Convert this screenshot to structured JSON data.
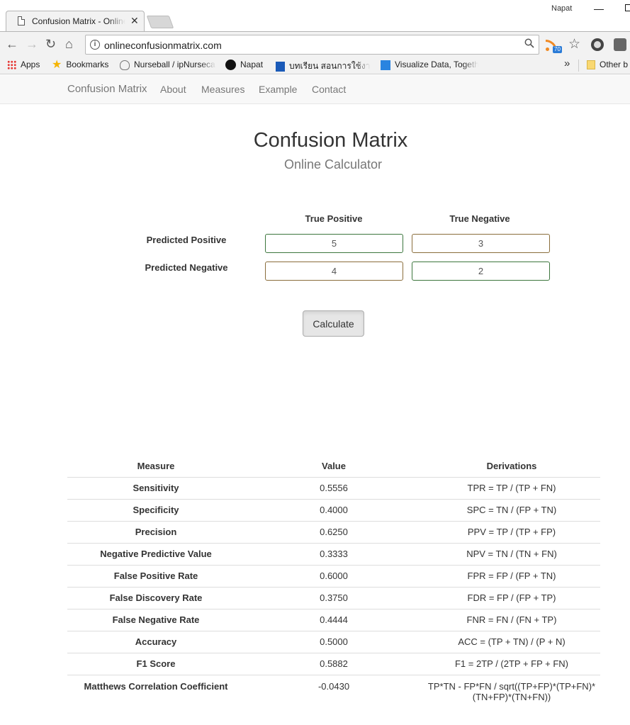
{
  "browser": {
    "tab_title": "Confusion Matrix - Online",
    "profile_name": "Napat",
    "url": "onlineconfusionmatrix.com",
    "rss_badge": "70",
    "bookmarks": [
      {
        "label": "Apps",
        "icon": "apps-grid-icon"
      },
      {
        "label": "Bookmarks",
        "icon": "star-icon"
      },
      {
        "label": "Nurseball / ipNurseca",
        "icon": "cat-icon"
      },
      {
        "label": "Napat",
        "icon": "github-icon"
      },
      {
        "label": "บทเรียน สอนการใช้งาน p",
        "icon": "doc-icon"
      },
      {
        "label": "Visualize Data, Togeth",
        "icon": "chart-icon"
      }
    ],
    "other_bookmarks": "Other b"
  },
  "nav": {
    "brand": "Confusion Matrix",
    "links": [
      "About",
      "Measures",
      "Example",
      "Contact"
    ]
  },
  "header": {
    "title": "Confusion Matrix",
    "subtitle": "Online Calculator"
  },
  "matrix": {
    "col_true_positive": "True Positive",
    "col_true_negative": "True Negative",
    "row_predicted_positive": "Predicted Positive",
    "row_predicted_negative": "Predicted Negative",
    "tp": "5",
    "fp": "3",
    "fn": "4",
    "tn": "2"
  },
  "calculate_label": "Calculate",
  "results": {
    "headers": [
      "Measure",
      "Value",
      "Derivations"
    ],
    "rows": [
      {
        "measure": "Sensitivity",
        "value": "0.5556",
        "derivation": "TPR = TP / (TP + FN)"
      },
      {
        "measure": "Specificity",
        "value": "0.4000",
        "derivation": "SPC = TN / (FP + TN)"
      },
      {
        "measure": "Precision",
        "value": "0.6250",
        "derivation": "PPV = TP / (TP + FP)"
      },
      {
        "measure": "Negative Predictive Value",
        "value": "0.3333",
        "derivation": "NPV = TN / (TN + FN)"
      },
      {
        "measure": "False Positive Rate",
        "value": "0.6000",
        "derivation": "FPR = FP / (FP + TN)"
      },
      {
        "measure": "False Discovery Rate",
        "value": "0.3750",
        "derivation": "FDR = FP / (FP + TP)"
      },
      {
        "measure": "False Negative Rate",
        "value": "0.4444",
        "derivation": "FNR = FN / (FN + TP)"
      },
      {
        "measure": "Accuracy",
        "value": "0.5000",
        "derivation": "ACC = (TP + TN) / (P + N)"
      },
      {
        "measure": "F1 Score",
        "value": "0.5882",
        "derivation": "F1 = 2TP / (2TP + FP + FN)"
      },
      {
        "measure": "Matthews Correlation Coefficient",
        "value": "-0.0430",
        "derivation": "TP*TN - FP*FN / sqrt((TP+FP)*(TP+FN)*(TN+FP)*(TN+FN))"
      }
    ]
  }
}
